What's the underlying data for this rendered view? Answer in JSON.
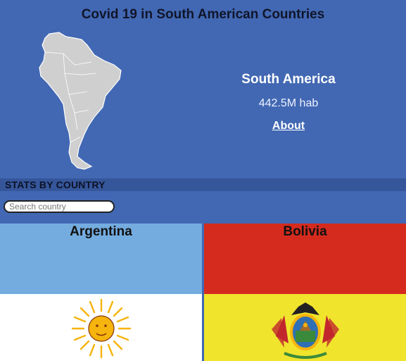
{
  "header": {
    "title": "Covid 19 in South American Countries"
  },
  "region": {
    "name": "South America",
    "population": "442.5M hab",
    "about_label": "About"
  },
  "stats": {
    "title": "STATS BY COUNTRY",
    "search_placeholder": "Search country"
  },
  "countries": [
    {
      "name": "Argentina",
      "flag_colors": {
        "top": "#74acdf",
        "bottom": "#ffffff",
        "emblem": "#f6b40e"
      },
      "emblem_icon": "sun-of-may-icon"
    },
    {
      "name": "Bolivia",
      "flag_colors": {
        "top": "#d52b1e",
        "bottom": "#f0e42c",
        "emblem": "#c1272d"
      },
      "emblem_icon": "bolivia-coat-of-arms-icon"
    }
  ],
  "colors": {
    "background": "#4268b3",
    "stats_bar": "#35569a",
    "map_fill": "#cfcfcf"
  }
}
